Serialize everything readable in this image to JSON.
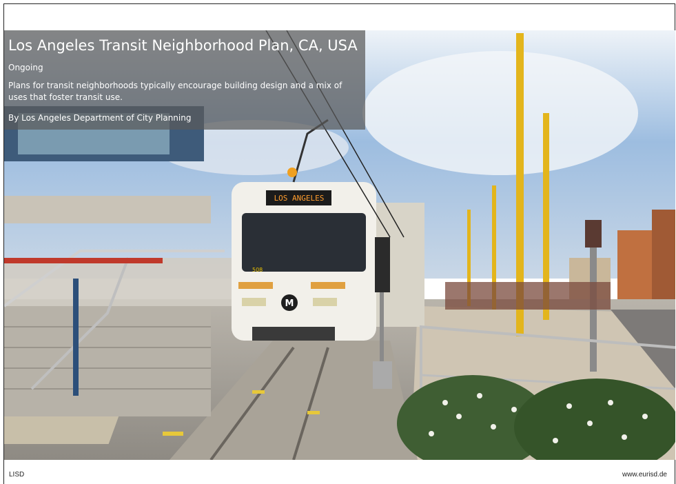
{
  "caption": {
    "title": "Los Angeles Transit Neighborhood Plan, CA, USA",
    "status": "Ongoing",
    "description": "Plans for transit neighborhoods typically encourage building design and a mix of uses that foster transit use.",
    "author": "By Los Angeles Department of City Planning"
  },
  "photo": {
    "train_destination": "LOS ANGELES",
    "train_number": "508",
    "metro_logo": "M"
  },
  "footer": {
    "left": "LISD",
    "right": "www.eurisd.de"
  },
  "colors": {
    "caption_bg": "#5a5a5a",
    "sky": "#7fa8d8",
    "pole_yellow": "#e3b51c",
    "train_white": "#f2f0ea",
    "stripe_orange": "#e0a040"
  }
}
